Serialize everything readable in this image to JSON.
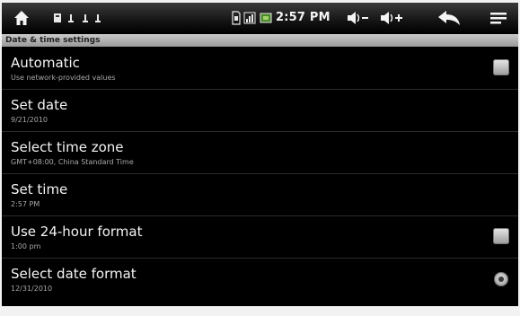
{
  "status_bar": {
    "time": "2:57 PM",
    "icons": [
      "home-icon",
      "notification-icons",
      "sd-card-icon",
      "signal-icon",
      "battery-icon",
      "volume-down-icon",
      "volume-up-icon",
      "back-icon",
      "menu-icon"
    ]
  },
  "title": "Date & time settings",
  "settings": [
    {
      "title": "Automatic",
      "summary": "Use network-provided values",
      "widget": "checkbox"
    },
    {
      "title": "Set date",
      "summary": "9/21/2010",
      "widget": "none"
    },
    {
      "title": "Select time zone",
      "summary": "GMT+08:00, China Standard Time",
      "widget": "none"
    },
    {
      "title": "Set time",
      "summary": "2:57 PM",
      "widget": "none"
    },
    {
      "title": "Use 24-hour format",
      "summary": "1:00 pm",
      "widget": "checkbox"
    },
    {
      "title": "Select date format",
      "summary": "12/31/2010",
      "widget": "dropdown"
    }
  ]
}
